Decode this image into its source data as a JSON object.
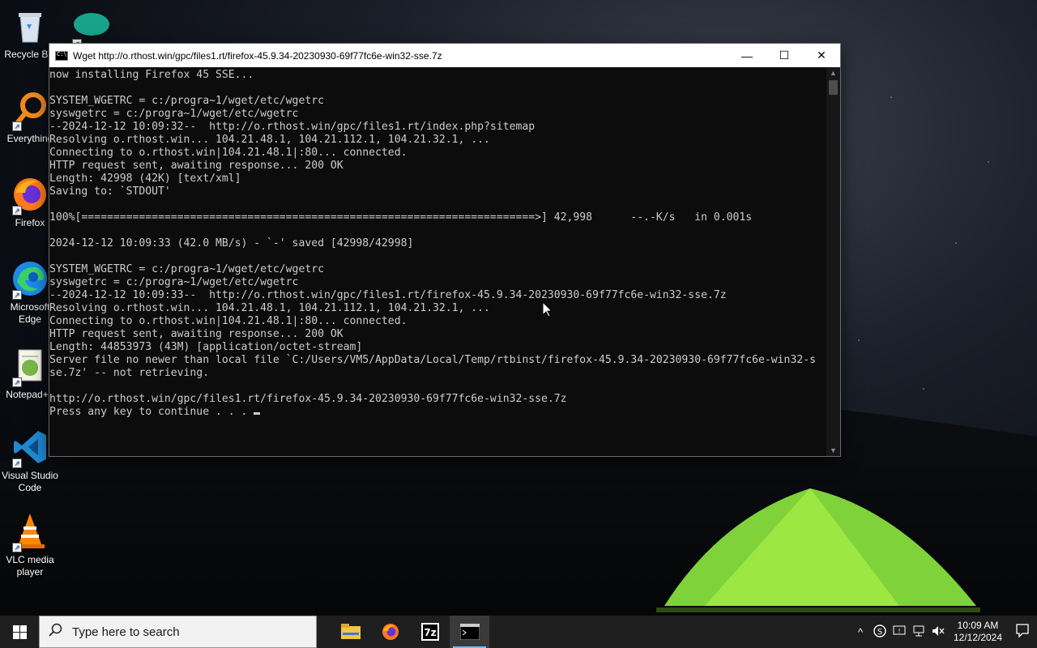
{
  "desktop": {
    "icons": [
      {
        "label": "Recycle Bin",
        "icon": "recycle-bin-icon"
      },
      {
        "label": "Everything",
        "icon": "everything-search-icon"
      },
      {
        "label": "Firefox",
        "icon": "firefox-icon"
      },
      {
        "label": "Microsoft Edge",
        "icon": "edge-icon"
      },
      {
        "label": "Notepad++",
        "icon": "notepad-plus-plus-icon"
      },
      {
        "label": "Visual Studio Code",
        "icon": "vscode-icon"
      },
      {
        "label": "VLC media player",
        "icon": "vlc-icon"
      },
      {
        "label": "",
        "icon": "viettel-icon"
      }
    ]
  },
  "window": {
    "title": "Wget http://o.rthost.win/gpc/files1.rt/firefox-45.9.34-20230930-69f77fc6e-win32-sse.7z",
    "minimize_glyph": "—",
    "maximize_glyph": "☐",
    "close_glyph": "✕",
    "console_lines": [
      "now installing Firefox 45 SSE...",
      "",
      "SYSTEM_WGETRC = c:/progra~1/wget/etc/wgetrc",
      "syswgetrc = c:/progra~1/wget/etc/wgetrc",
      "--2024-12-12 10:09:32--  http://o.rthost.win/gpc/files1.rt/index.php?sitemap",
      "Resolving o.rthost.win... 104.21.48.1, 104.21.112.1, 104.21.32.1, ...",
      "Connecting to o.rthost.win|104.21.48.1|:80... connected.",
      "HTTP request sent, awaiting response... 200 OK",
      "Length: 42998 (42K) [text/xml]",
      "Saving to: `STDOUT'",
      "",
      "100%[=======================================================================>] 42,998      --.-K/s   in 0.001s",
      "",
      "2024-12-12 10:09:33 (42.0 MB/s) - `-' saved [42998/42998]",
      "",
      "SYSTEM_WGETRC = c:/progra~1/wget/etc/wgetrc",
      "syswgetrc = c:/progra~1/wget/etc/wgetrc",
      "--2024-12-12 10:09:33--  http://o.rthost.win/gpc/files1.rt/firefox-45.9.34-20230930-69f77fc6e-win32-sse.7z",
      "Resolving o.rthost.win... 104.21.48.1, 104.21.112.1, 104.21.32.1, ...",
      "Connecting to o.rthost.win|104.21.48.1|:80... connected.",
      "HTTP request sent, awaiting response... 200 OK",
      "Length: 44853973 (43M) [application/octet-stream]",
      "Server file no newer than local file `C:/Users/VM5/AppData/Local/Temp/rtbinst/firefox-45.9.34-20230930-69f77fc6e-win32-s",
      "se.7z' -- not retrieving.",
      "",
      "http://o.rthost.win/gpc/files1.rt/firefox-45.9.34-20230930-69f77fc6e-win32-sse.7z",
      "Press any key to continue . . . "
    ]
  },
  "taskbar": {
    "search_placeholder": "Type here to search",
    "apps": [
      "file-explorer-icon",
      "firefox-icon",
      "7zip-icon",
      "console-icon"
    ],
    "active_app": "console-icon",
    "clock_time": "10:09 AM",
    "clock_date": "12/12/2024",
    "chevron": "^"
  },
  "colors": {
    "console_bg": "#0c0c0c",
    "console_fg": "#cccccc",
    "taskbar_bg": "#1f1f1f",
    "active_indicator": "#76b9ed"
  }
}
